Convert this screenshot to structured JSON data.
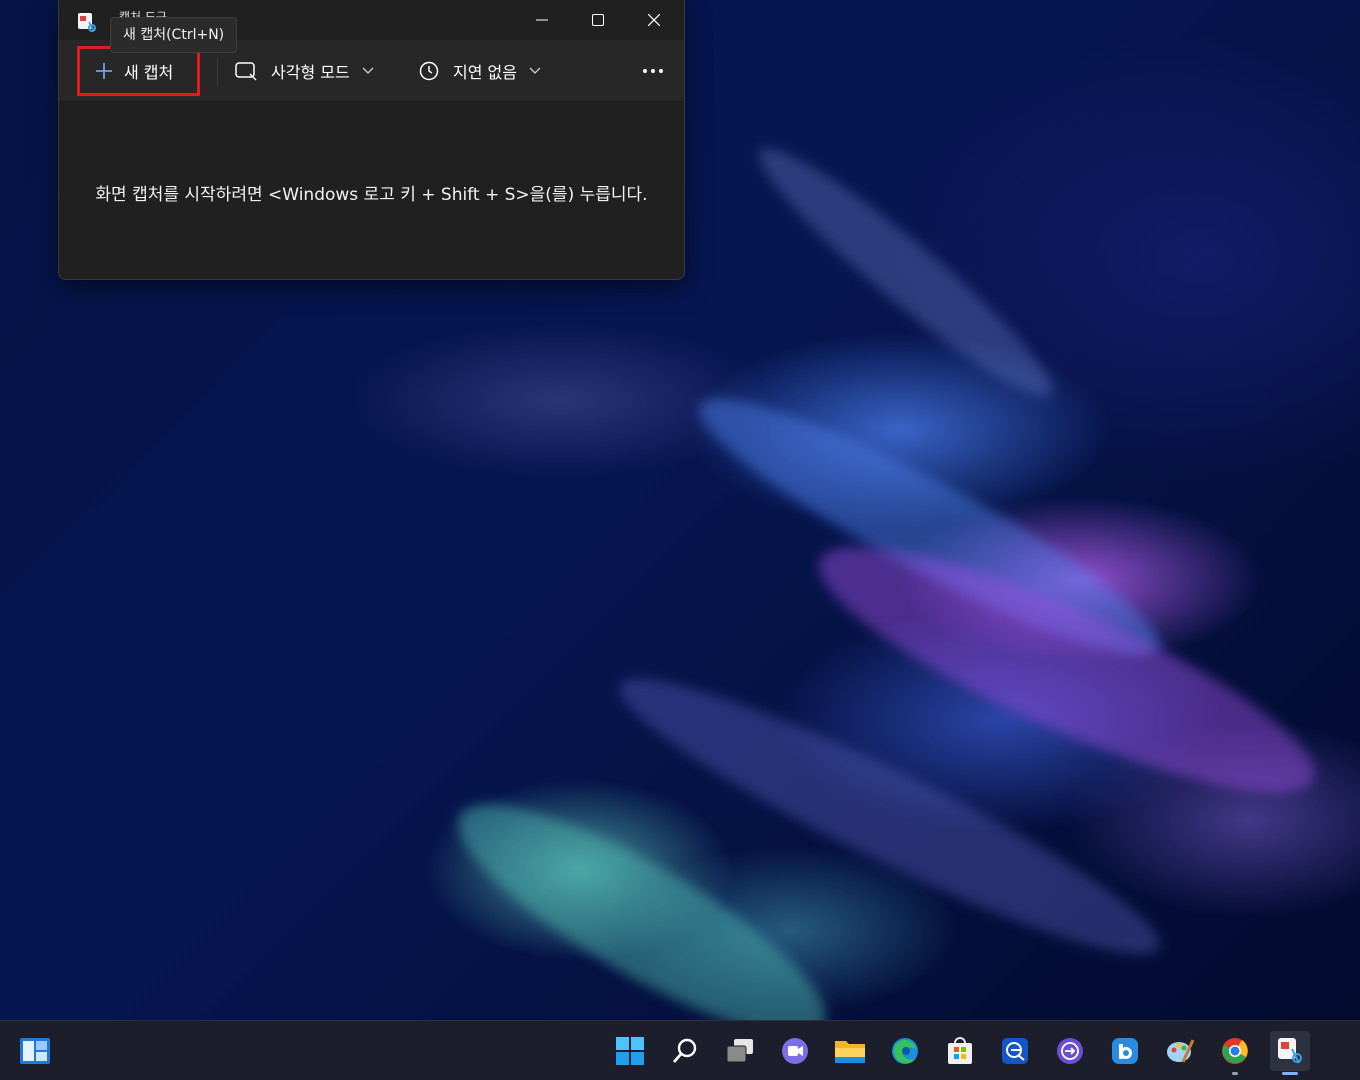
{
  "window": {
    "title": "캡처 도구",
    "tooltip": "새 캡처(Ctrl+N)"
  },
  "toolbar": {
    "new_capture_label": "새 캡처",
    "mode_label": "사각형 모드",
    "delay_label": "지연 없음"
  },
  "content": {
    "hint": "화면 캡처를 시작하려면 <Windows 로고 키 + Shift + S>을(를) 누릅니다."
  },
  "highlight_color": "#e01e1e",
  "taskbar": {
    "icons": [
      "widgets-icon",
      "start-icon",
      "search-icon",
      "task-view-icon",
      "chat-icon",
      "file-explorer-icon",
      "edge-icon",
      "store-icon",
      "app-icon",
      "quick-assist-icon",
      "bing-icon",
      "paint-icon",
      "chrome-icon",
      "snipping-tool-icon"
    ]
  }
}
